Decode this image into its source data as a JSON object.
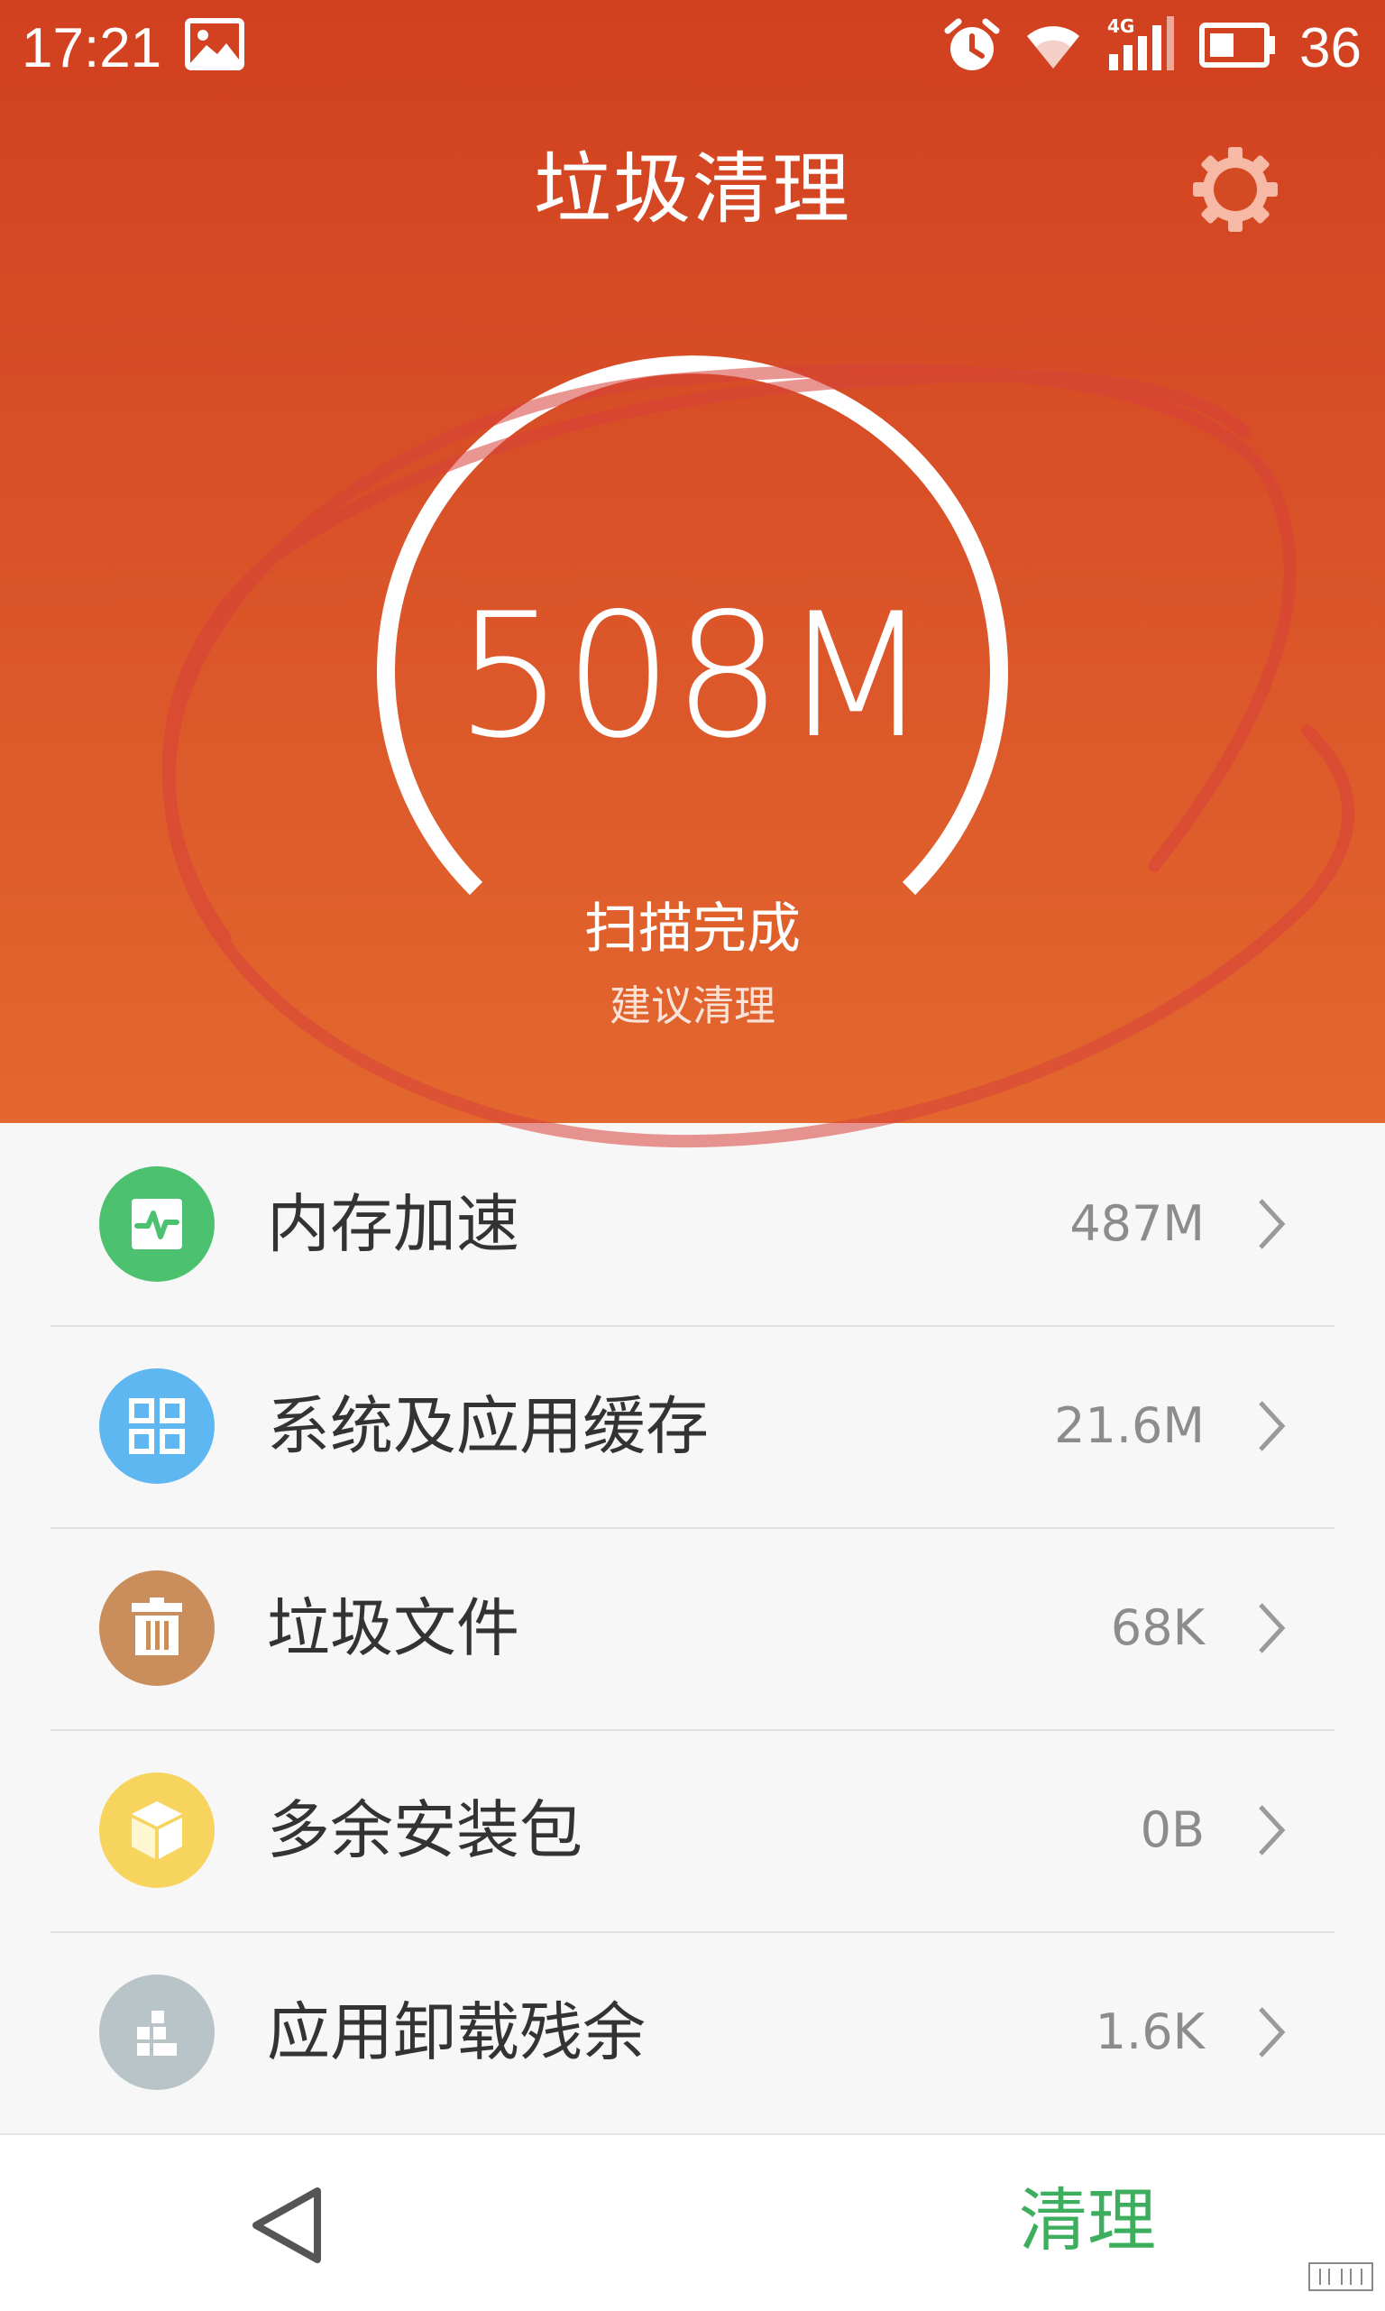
{
  "statusbar": {
    "time": "17:21",
    "battery": "36",
    "icons": [
      "image-icon",
      "alarm-icon",
      "wifi-icon",
      "signal-4g-icon",
      "battery-icon"
    ]
  },
  "header": {
    "title": "垃圾清理",
    "settings_icon": "gear-icon"
  },
  "summary": {
    "total": "508M",
    "status": "扫描完成",
    "hint": "建议清理"
  },
  "items": [
    {
      "label": "内存加速",
      "value": "487M",
      "icon": "pulse-icon",
      "color": "#4cc271"
    },
    {
      "label": "系统及应用缓存",
      "value": "21.6M",
      "icon": "grid-icon",
      "color": "#5fb7f1"
    },
    {
      "label": "垃圾文件",
      "value": "68K",
      "icon": "trash-icon",
      "color": "#c98e5c"
    },
    {
      "label": "多余安装包",
      "value": "0B",
      "icon": "package-icon",
      "color": "#f7d45e"
    },
    {
      "label": "应用卸载残余",
      "value": "1.6K",
      "icon": "blocks-icon",
      "color": "#b9c4c8"
    }
  ],
  "bottombar": {
    "back_icon": "back-triangle-icon",
    "clean_label": "清理"
  },
  "colors": {
    "header_top": "#d1401f",
    "header_bottom": "#e3672e",
    "accent_green": "#3cae5e",
    "annotation_red": "#d8413a"
  }
}
